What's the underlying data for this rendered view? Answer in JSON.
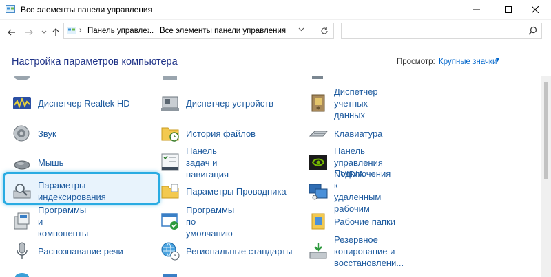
{
  "window": {
    "title": "Все элементы панели управления"
  },
  "navigation": {
    "breadcrumbs": [
      "Панель управле...",
      "Все элементы панели управления"
    ],
    "search_placeholder": ""
  },
  "header": {
    "title": "Настройка параметров компьютера",
    "view_label": "Просмотр:",
    "view_value": "Крупные значки"
  },
  "items": [
    {
      "label": "Диспетчер Realtek HD",
      "icon": "realtek-audio-icon"
    },
    {
      "label": "Диспетчер устройств",
      "icon": "device-manager-icon"
    },
    {
      "label": "Диспетчер учетных\nданных",
      "icon": "credential-manager-icon"
    },
    {
      "label": "Звук",
      "icon": "speaker-icon"
    },
    {
      "label": "История файлов",
      "icon": "file-history-icon"
    },
    {
      "label": "Клавиатура",
      "icon": "keyboard-icon"
    },
    {
      "label": "Мышь",
      "icon": "mouse-icon"
    },
    {
      "label": "Панель задач и\nнавигация",
      "icon": "taskbar-icon"
    },
    {
      "label": "Панель управления\nNVIDIA",
      "icon": "nvidia-icon"
    },
    {
      "label": "Параметры\nиндексирования",
      "icon": "indexing-icon"
    },
    {
      "label": "Параметры Проводника",
      "icon": "folder-options-icon"
    },
    {
      "label": "Подключения к\nудаленным рабочим",
      "icon": "remote-desktop-icon"
    },
    {
      "label": "Программы и\nкомпоненты",
      "icon": "programs-icon"
    },
    {
      "label": "Программы по\nумолчанию",
      "icon": "default-programs-icon"
    },
    {
      "label": "Рабочие папки",
      "icon": "work-folders-icon"
    },
    {
      "label": "Распознавание речи",
      "icon": "microphone-icon"
    },
    {
      "label": "Региональные стандарты",
      "icon": "globe-clock-icon"
    },
    {
      "label": "Резервное копирование и\nвосстановлени...",
      "icon": "backup-icon"
    }
  ]
}
